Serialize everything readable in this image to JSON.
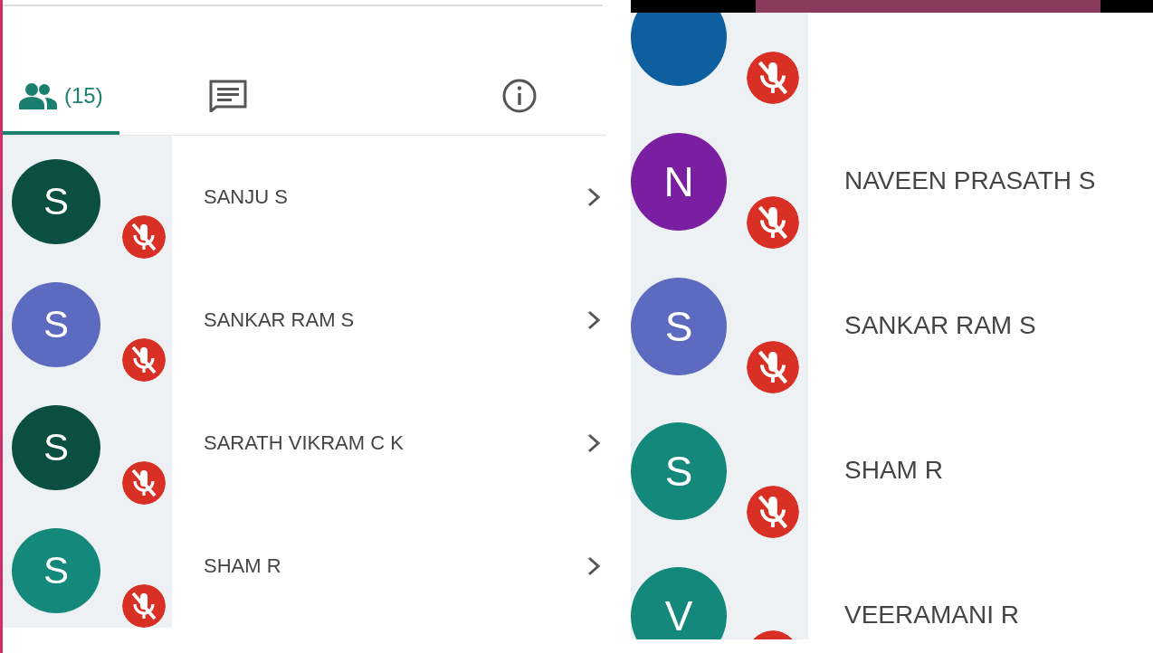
{
  "left_panel": {
    "tabs": [
      {
        "kind": "people",
        "label": "(15)",
        "selected": true
      },
      {
        "kind": "chat",
        "selected": false
      },
      {
        "kind": "info",
        "selected": false
      }
    ],
    "participants": [
      {
        "initial": "S",
        "name": "SANJU S",
        "color": "#0b4f43",
        "muted": true
      },
      {
        "initial": "S",
        "name": "SANKAR RAM S",
        "color": "#5c6bc0",
        "muted": true
      },
      {
        "initial": "S",
        "name": "SARATH VIKRAM C K",
        "color": "#0b4f43",
        "muted": true
      },
      {
        "initial": "S",
        "name": "SHAM R",
        "color": "#14897b",
        "muted": true
      }
    ]
  },
  "right_panel": {
    "participants": [
      {
        "color": "#0d5fa0",
        "muted": true
      },
      {
        "initial": "N",
        "name": "NAVEEN PRASATH S",
        "color": "#7b1fa2",
        "muted": true
      },
      {
        "initial": "S",
        "name": "SANKAR RAM S",
        "color": "#5c6bc0",
        "muted": true
      },
      {
        "initial": "S",
        "name": "SHAM R",
        "color": "#14897b",
        "muted": true
      },
      {
        "initial": "V",
        "name": "VEERAMANI R",
        "color": "#14897b",
        "muted": true
      }
    ]
  }
}
